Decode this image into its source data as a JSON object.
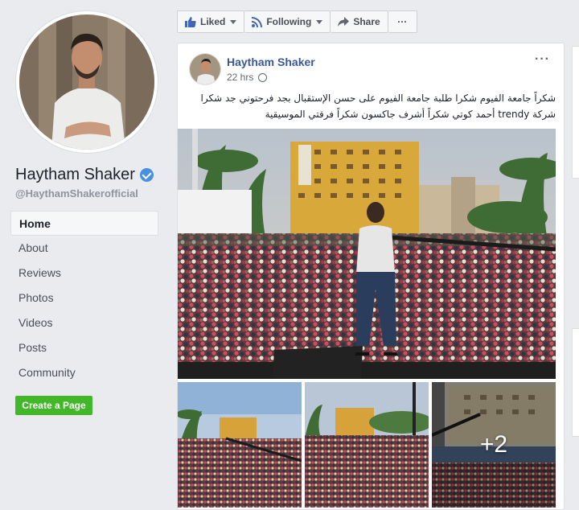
{
  "sidebar": {
    "page_name": "Haytham Shaker",
    "handle": "@HaythamShakerofficial",
    "nav": [
      {
        "label": "Home",
        "active": true
      },
      {
        "label": "About"
      },
      {
        "label": "Reviews"
      },
      {
        "label": "Photos"
      },
      {
        "label": "Videos"
      },
      {
        "label": "Posts"
      },
      {
        "label": "Community"
      }
    ],
    "create_page_label": "Create a Page"
  },
  "actions": {
    "liked_label": "Liked",
    "following_label": "Following",
    "share_label": "Share",
    "more_label": "···"
  },
  "post": {
    "author": "Haytham Shaker",
    "time": "22 hrs",
    "more_label": "···",
    "text": "شكراً جامعة الفيوم شكرا طلبة جامعة الفيوم على حسن الإستقبال بجد فرحتوني جد شكرا شركة trendy أحمد كوتي شكراً أشرف جاكسون شكراً فرقتي الموسيقية",
    "extra_photos": "+2"
  },
  "colors": {
    "link": "#385898",
    "create_button": "#42b72a",
    "verified": "#4a90e2",
    "page_bg": "#e9ebee"
  }
}
